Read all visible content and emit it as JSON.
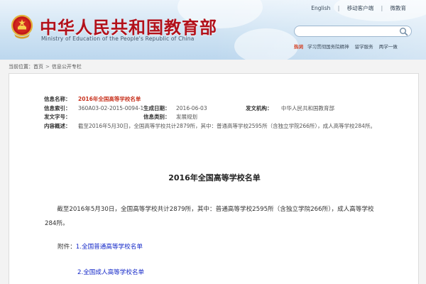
{
  "header": {
    "site_title": "中华人民共和国教育部",
    "site_subtitle": "Ministry of Education of the People's Republic of China",
    "top_links": [
      "English",
      "移动客户端",
      "微教育"
    ],
    "search_placeholder": "",
    "hot_label": "热词",
    "hot_words": [
      "学习贯彻国务院精神",
      "留学服务",
      "两学一做"
    ]
  },
  "breadcrumb": {
    "prefix": "当前位置：",
    "items": [
      "首页",
      "信息公开专栏"
    ]
  },
  "meta": {
    "title_key": "信息名称：",
    "title_value": "2016年全国高等学校名单",
    "index_key": "信息索引：",
    "index_value": "360A03-02-2015-0094-1",
    "date_key": "生成日期：",
    "date_value": "2016-06-03",
    "org_key": "发文机构：",
    "org_value": "中华人民共和国教育部",
    "docno_key": "发文字号：",
    "docno_value": "",
    "category_key": "信息类别：",
    "category_value": "发展规划",
    "summary_key": "内容概述：",
    "summary_value": "截至2016年5月30日，全国高等学校共计2879所，其中：普通高等学校2595所（含独立学院266所），成人高等学校284所。"
  },
  "document": {
    "title": "2016年全国高等学校名单",
    "paragraph": "截至2016年5月30日，全国高等学校共计2879所，其中：普通高等学校2595所（含独立学院266所），成人高等学校284所。",
    "attachment_label": "附件：",
    "attachments": [
      "1.全国普通高等学校名单",
      "2.全国成人高等学校名单"
    ]
  },
  "colors": {
    "brand_red": "#b2111b",
    "title_red": "#c8321e",
    "link_blue": "#1428c8"
  }
}
